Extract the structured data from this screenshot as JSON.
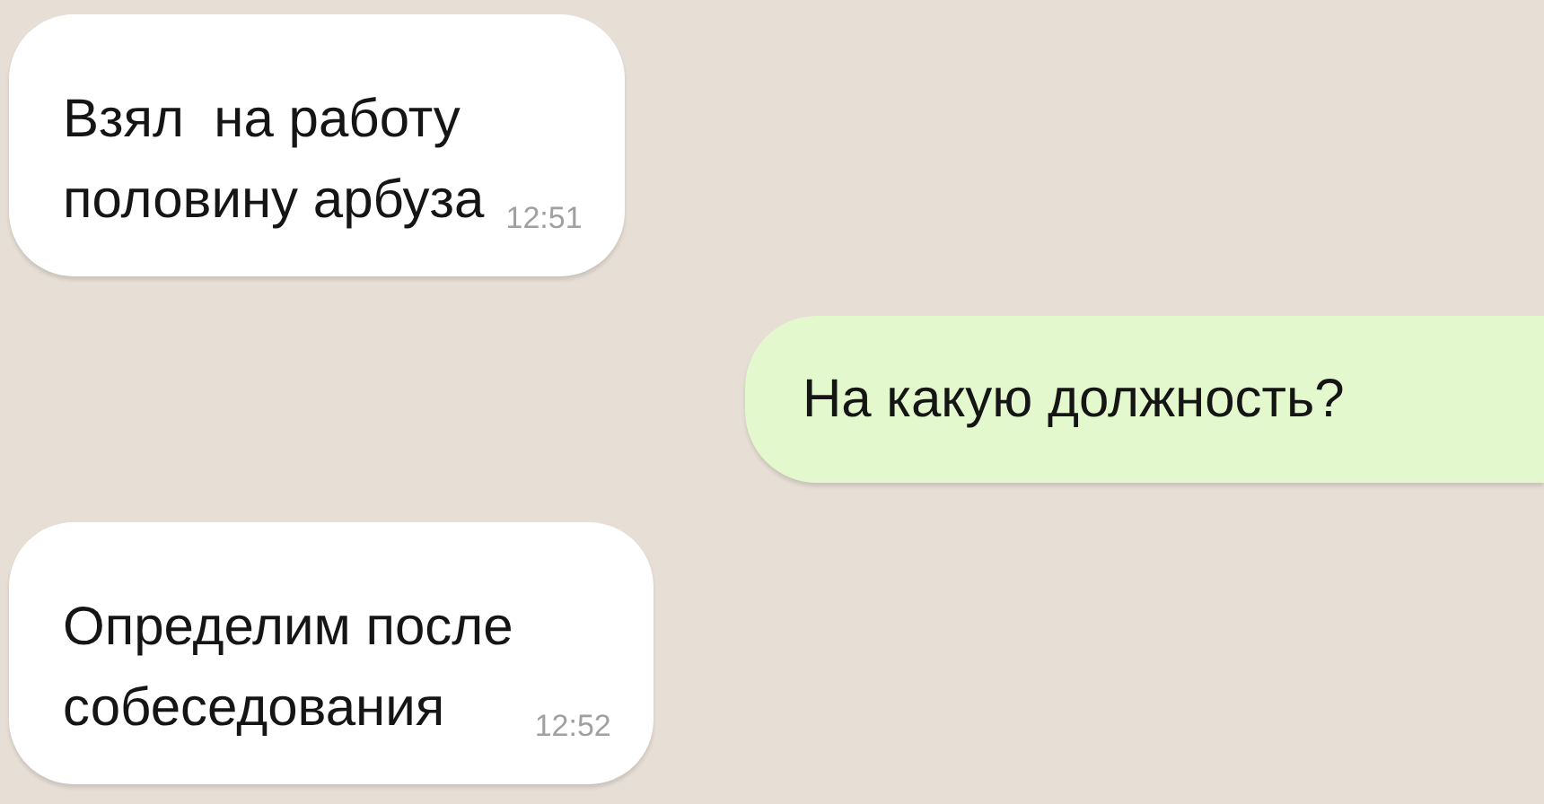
{
  "messages": [
    {
      "kind": "incoming",
      "lines": [
        "Взял  на работу",
        "половину арбуза"
      ],
      "time": "12:51"
    },
    {
      "kind": "outgoing",
      "lines": [
        "На какую должность?"
      ]
    },
    {
      "kind": "incoming",
      "lines": [
        "Определим после",
        "собеседования"
      ],
      "time": "12:52"
    }
  ]
}
